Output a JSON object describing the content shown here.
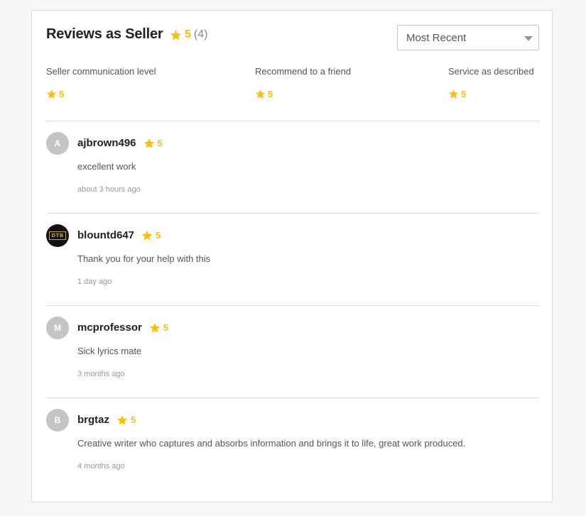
{
  "header": {
    "title": "Reviews as Seller",
    "rating": "5",
    "count": "(4)",
    "sort_selected": "Most Recent"
  },
  "criteria": [
    {
      "name": "Seller communication level",
      "rating": "5"
    },
    {
      "name": "Recommend to a friend",
      "rating": "5"
    },
    {
      "name": "Service as described",
      "rating": "5"
    }
  ],
  "reviews": [
    {
      "initial": "A",
      "username": "ajbrown496",
      "rating": "5",
      "text": "excellent work",
      "time": "about 3 hours ago"
    },
    {
      "initial": "DTB",
      "username": "blountd647",
      "rating": "5",
      "text": "Thank you for your help with this",
      "time": "1 day ago"
    },
    {
      "initial": "M",
      "username": "mcprofessor",
      "rating": "5",
      "text": "Sick lyrics mate",
      "time": "3 months ago"
    },
    {
      "initial": "B",
      "username": "brgtaz",
      "rating": "5",
      "text": "Creative writer who captures and absorbs information and brings it to life, great work produced.",
      "time": "4 months ago"
    }
  ],
  "colors": {
    "star": "#ffbe0b",
    "background": "#f7f7f7",
    "divider": "#dcdcdc"
  },
  "icons": {
    "rating": "star-icon",
    "sort": "chevron-down-icon"
  }
}
